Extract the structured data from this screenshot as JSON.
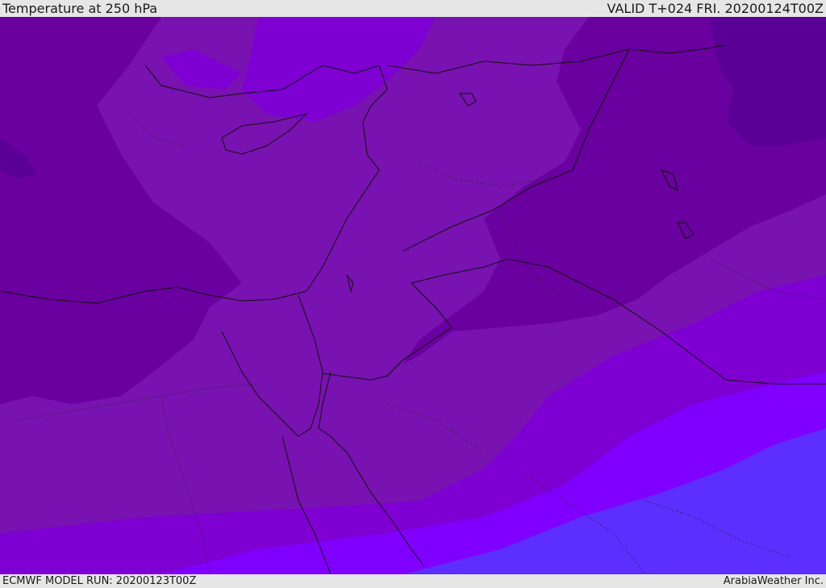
{
  "header": {
    "title": "Temperature at 250 hPa",
    "valid": "VALID T+024 FRI. 20200124T00Z"
  },
  "footer": {
    "model_run": "ECMWF MODEL RUN: 20200123T00Z",
    "brand": "ArabiaWeather Inc."
  },
  "map": {
    "colors": {
      "coldest": "#5a0096",
      "cold": "#69009f",
      "cool": "#7812b0",
      "mid": "#7e00d2",
      "warm": "#8000ff",
      "warmest": "#5c2eff",
      "coast": "#111111"
    }
  }
}
